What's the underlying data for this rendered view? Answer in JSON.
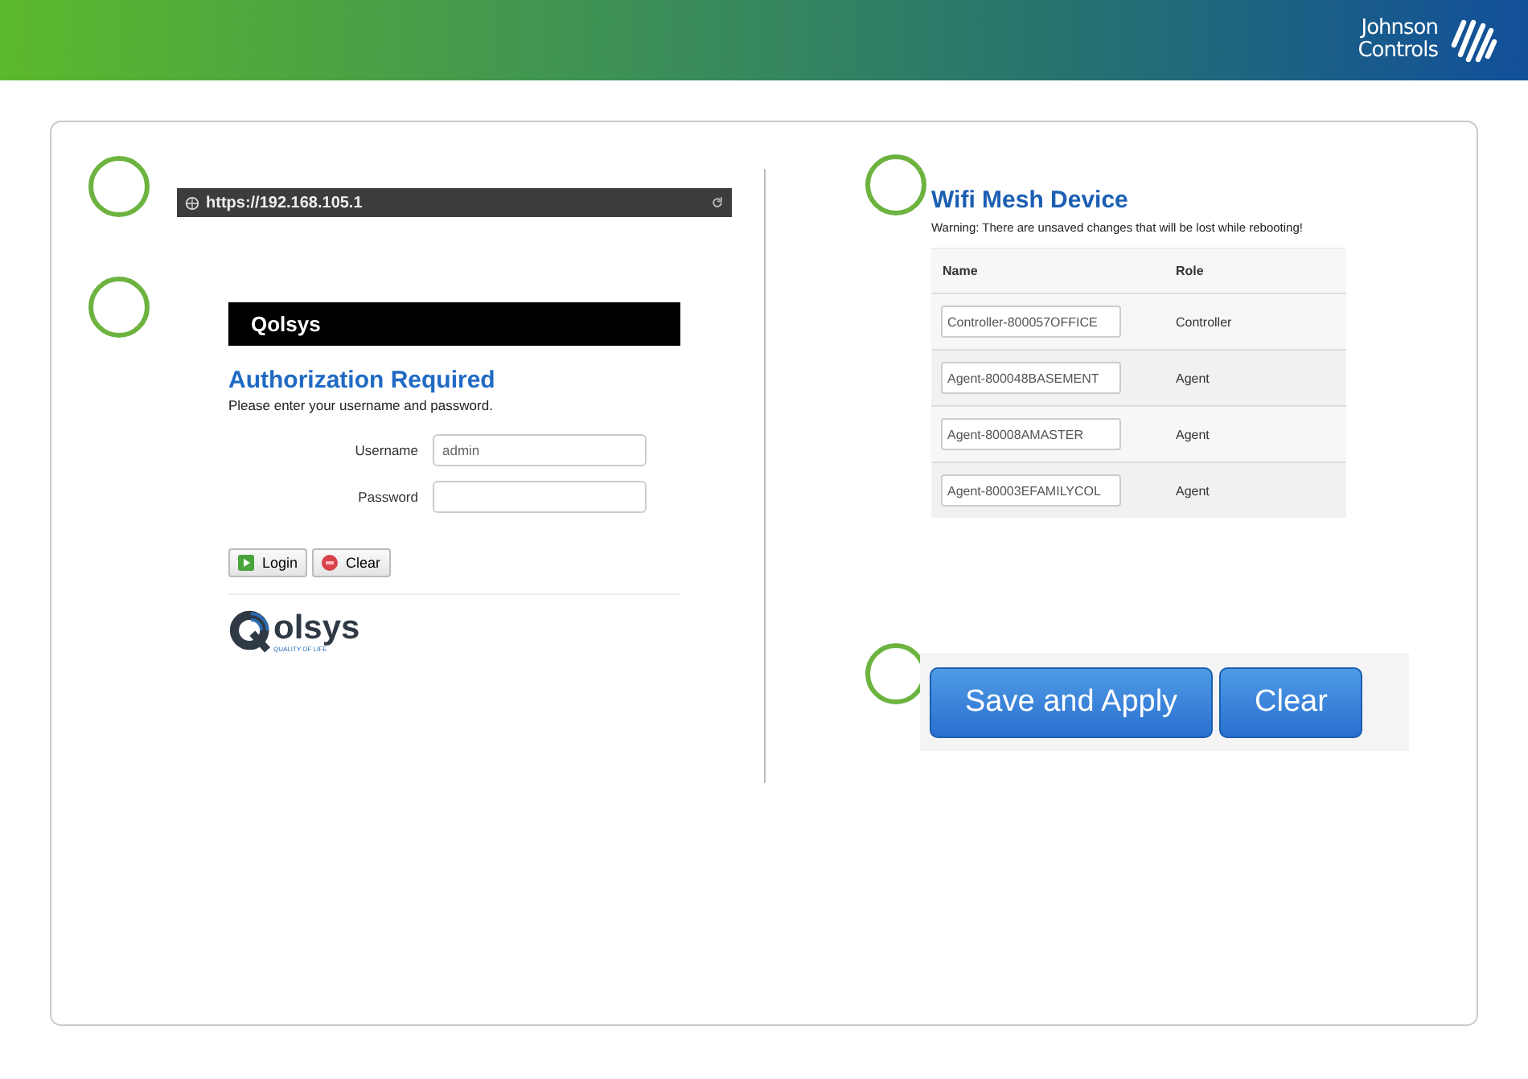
{
  "header": {
    "brand": [
      "Johnson",
      "Controls"
    ]
  },
  "url_bar": {
    "url": "https://192.168.105.1"
  },
  "login": {
    "brand": "Qolsys",
    "title": "Authorization Required",
    "prompt": "Please enter your username and password.",
    "fields": [
      {
        "label": "Username",
        "value": "admin"
      },
      {
        "label": "Password"
      }
    ],
    "buttons": [
      {
        "label": "Login",
        "kind": "go"
      },
      {
        "label": "Clear",
        "kind": "reset"
      }
    ],
    "footer_logo": {
      "brand": "olsys",
      "tagline": "QUALITY OF LIFE"
    }
  },
  "mesh": {
    "title": "Wifi Mesh Device",
    "warning": "Warning: There are unsaved changes that will be lost while rebooting!",
    "columns": [
      "Name",
      "Role"
    ],
    "rows": [
      {
        "name": "Controller-800057OFFICE",
        "role": "Controller"
      },
      {
        "name": "Agent-800048BASEMENT",
        "role": "Agent"
      },
      {
        "name": "Agent-80008AMASTER",
        "role": "Agent"
      },
      {
        "name": "Agent-80003EFAMILYCOL",
        "role": "Agent"
      }
    ]
  },
  "actions": {
    "buttons": [
      "Save and Apply",
      "Clear"
    ]
  }
}
